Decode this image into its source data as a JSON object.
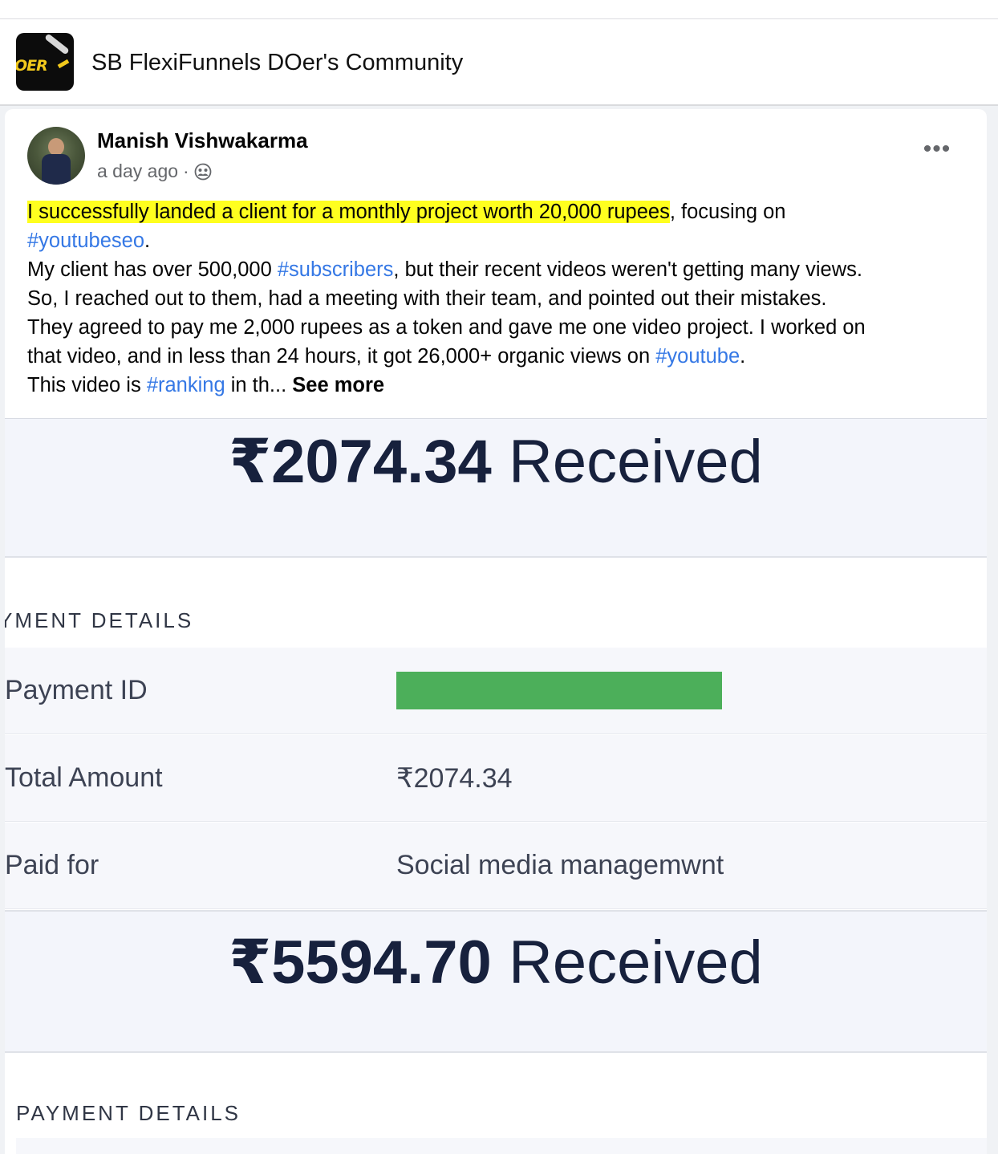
{
  "group": {
    "name": "SB FlexiFunnels DOer's Community",
    "logo_text": "OER"
  },
  "post": {
    "author": "Manish Vishwakarma",
    "time": "a day ago",
    "privacy_separator": "·",
    "text": {
      "highlighted": "I successfully landed a client for a monthly project worth 20,000 rupees",
      "p1_after": ", focusing on",
      "tag_youtubeseo": "#youtubeseo",
      "period1": ".",
      "p2_before": "My client has over 500,000 ",
      "tag_subscribers": "#subscribers",
      "p2_after": ", but their recent videos weren't getting many views.",
      "p3": "So, I reached out to them, had a meeting with their team, and pointed out their mistakes.",
      "p4": "They agreed to pay me 2,000 rupees as a token and gave me one video project. I worked on",
      "p5_before": "that video, and in less than 24 hours, it got 26,000+ organic views on ",
      "tag_youtube": "#youtube",
      "period2": ".",
      "p6_before": "This video is ",
      "tag_ranking": "#ranking",
      "p6_after": " in th... ",
      "see_more": "See more"
    }
  },
  "receipt": {
    "first": {
      "amount": "₹2074.34",
      "received": "Received",
      "details_label": "YMENT DETAILS",
      "rows": [
        {
          "label": "Payment ID",
          "value": ""
        },
        {
          "label": "Total Amount",
          "value": "₹2074.34"
        },
        {
          "label": "Paid for",
          "value": "Social media managemwnt"
        }
      ]
    },
    "second": {
      "amount": "₹5594.70",
      "received": "Received",
      "details_label": "PAYMENT DETAILS"
    },
    "colors": {
      "highlight": "#ffff1f",
      "hashtag": "#3578e5",
      "redaction": "#4caf5a",
      "amount_text": "#17213d"
    }
  },
  "icons": {
    "privacy": "group-members-icon",
    "more": "more-options-icon"
  }
}
